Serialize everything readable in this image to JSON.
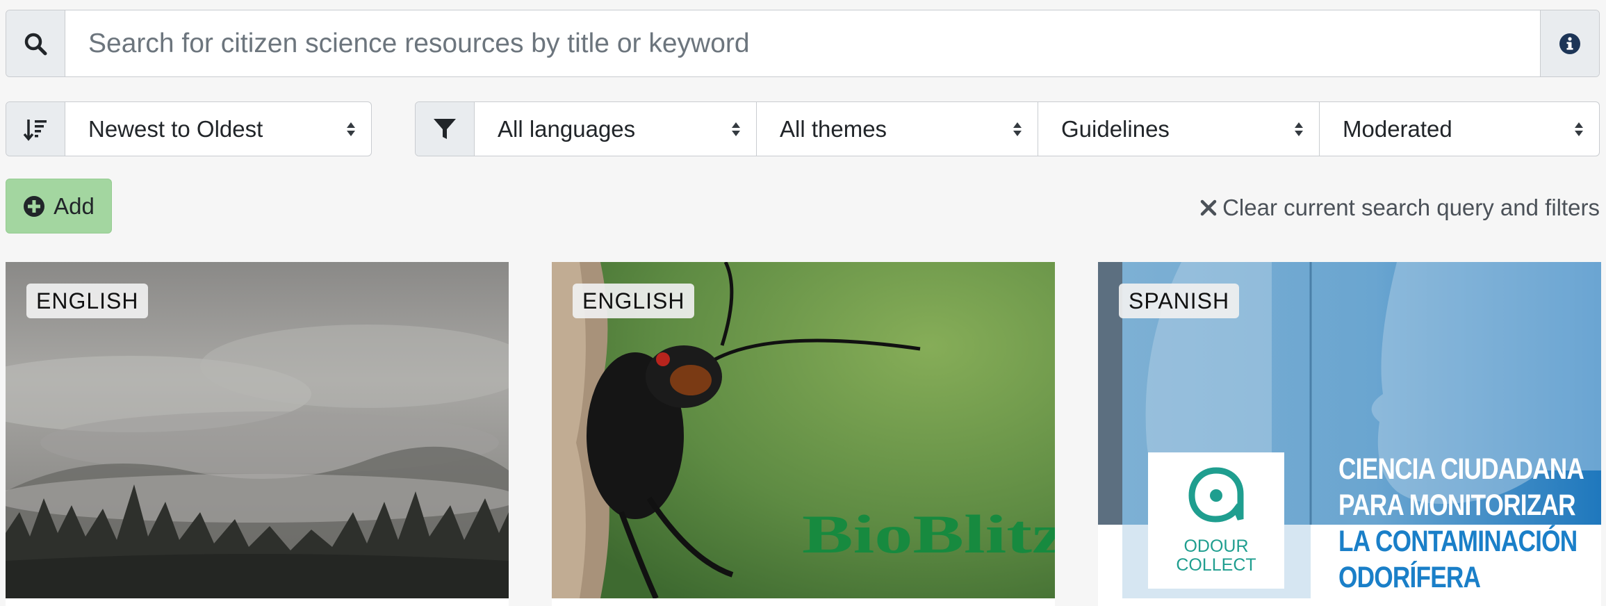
{
  "search": {
    "placeholder": "Search for citizen science resources by title or keyword",
    "search_icon": "search-icon",
    "info_icon": "info-icon"
  },
  "sort": {
    "icon": "sort-descending-icon",
    "selected": "Newest to Oldest"
  },
  "filters": {
    "icon": "filter-icon",
    "language": "All languages",
    "theme": "All themes",
    "category": "Guidelines",
    "moderation": "Moderated"
  },
  "actions": {
    "add_label": "Add",
    "add_icon": "plus-circle-icon",
    "clear_label": "Clear current search query and filters",
    "clear_icon": "close-icon"
  },
  "cards": [
    {
      "language": "ENGLISH",
      "image": "misty forest with clouds over mountains"
    },
    {
      "language": "ENGLISH",
      "image": "black beetle on plant against green background",
      "logo_text": "BioBlitz"
    },
    {
      "language": "SPANISH",
      "image": "odour collect citizen science poster",
      "logo_text": "ODOUR COLLECT",
      "headline_lines": [
        "CIENCIA CIUDADANA",
        "PARA MONITORIZAR",
        "LA CONTAMINACIÓN",
        "ODORÍFERA"
      ]
    }
  ],
  "colors": {
    "background": "#f6f6f6",
    "add_button": "#a3d6a0",
    "addon": "#e9ecef",
    "info_icon": "#1d3557",
    "odour_teal": "#1f9e8f",
    "headline_blue": "#1a7fc8"
  }
}
